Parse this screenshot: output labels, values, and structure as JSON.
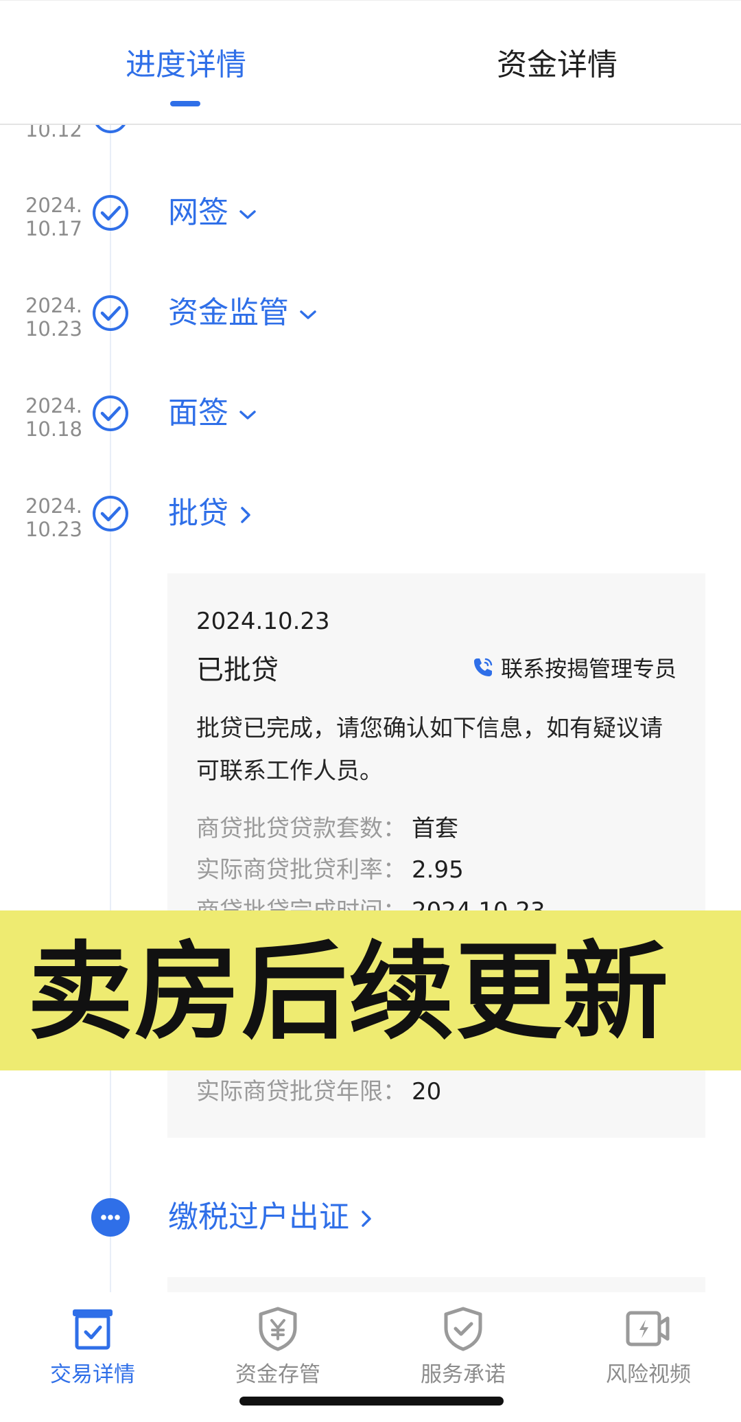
{
  "tabs": [
    {
      "label": "进度详情",
      "active": true
    },
    {
      "label": "资金详情",
      "active": false
    }
  ],
  "timeline": {
    "partial": {
      "date_line2": "10.12"
    },
    "steps": [
      {
        "date_line1": "2024.",
        "date_line2": "10.17",
        "label": "网签",
        "chevron": "chevron-down-icon",
        "status": "done"
      },
      {
        "date_line1": "2024.",
        "date_line2": "10.23",
        "label": "资金监管",
        "chevron": "chevron-down-icon",
        "status": "done"
      },
      {
        "date_line1": "2024.",
        "date_line2": "10.18",
        "label": "面签",
        "chevron": "chevron-down-icon",
        "status": "done"
      },
      {
        "date_line1": "2024.",
        "date_line2": "10.23",
        "label": "批贷",
        "chevron": "chevron-right-icon",
        "status": "done"
      }
    ],
    "pending": {
      "label": "缴税过户出证",
      "chevron": "chevron-right-icon",
      "status": "in-progress"
    }
  },
  "card": {
    "date": "2024.10.23",
    "status": "已批贷",
    "contact": "联系按揭管理专员",
    "description": "批贷已完成，请您确认如下信息，如有疑议请可联系工作人员。",
    "rows": [
      {
        "label": "商贷批贷贷款套数：",
        "value": "首套"
      },
      {
        "label": "实际商贷批贷利率：",
        "value": "2.95"
      },
      {
        "label": "商贷批贷完成时间：",
        "value": "2024.10.23"
      },
      {
        "label": "实际商贷批贷年限：",
        "value": "20"
      }
    ]
  },
  "banner": {
    "text": "卖房后续更新"
  },
  "bottom_nav": [
    {
      "label": "交易详情",
      "icon": "transaction-box-icon",
      "active": true
    },
    {
      "label": "资金存管",
      "icon": "yuan-shield-icon",
      "active": false
    },
    {
      "label": "服务承诺",
      "icon": "check-shield-icon",
      "active": false
    },
    {
      "label": "风险视频",
      "icon": "video-icon",
      "active": false
    }
  ],
  "colors": {
    "accent": "#2f6fe8",
    "banner": "#eeeb71",
    "muted": "#8c8c8c",
    "card_bg": "#f7f7f7"
  }
}
